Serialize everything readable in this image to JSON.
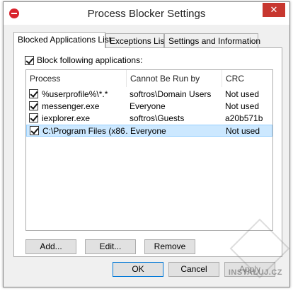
{
  "window": {
    "title": "Process Blocker Settings",
    "close_glyph": "✕"
  },
  "tabs": [
    {
      "label": "Blocked Applications List",
      "active": true
    },
    {
      "label": "Exceptions List",
      "active": false
    },
    {
      "label": "Settings and Information",
      "active": false
    }
  ],
  "block_checkbox": {
    "label": "Block following applications:",
    "checked": true
  },
  "list": {
    "columns": [
      "Process",
      "Cannot Be Run by",
      "CRC"
    ],
    "rows": [
      {
        "checked": true,
        "process": "%userprofile%\\*.*",
        "user": "softros\\Domain Users",
        "crc": "Not used",
        "selected": false
      },
      {
        "checked": true,
        "process": "messenger.exe",
        "user": "Everyone",
        "crc": "Not used",
        "selected": false
      },
      {
        "checked": true,
        "process": "iexplorer.exe",
        "user": "softros\\Guests",
        "crc": "a20b571b",
        "selected": false
      },
      {
        "checked": true,
        "process": "C:\\Program Files (x86…",
        "user": "Everyone",
        "crc": "Not used",
        "selected": true
      }
    ]
  },
  "buttons": {
    "add": "Add...",
    "edit": "Edit...",
    "remove": "Remove",
    "ok": "OK",
    "cancel": "Cancel",
    "apply": "Apply"
  },
  "watermark": "INSTALUJ.CZ",
  "colors": {
    "selection": "#cce8ff",
    "close_button": "#c7372f",
    "title_icon": "#d9232d"
  }
}
